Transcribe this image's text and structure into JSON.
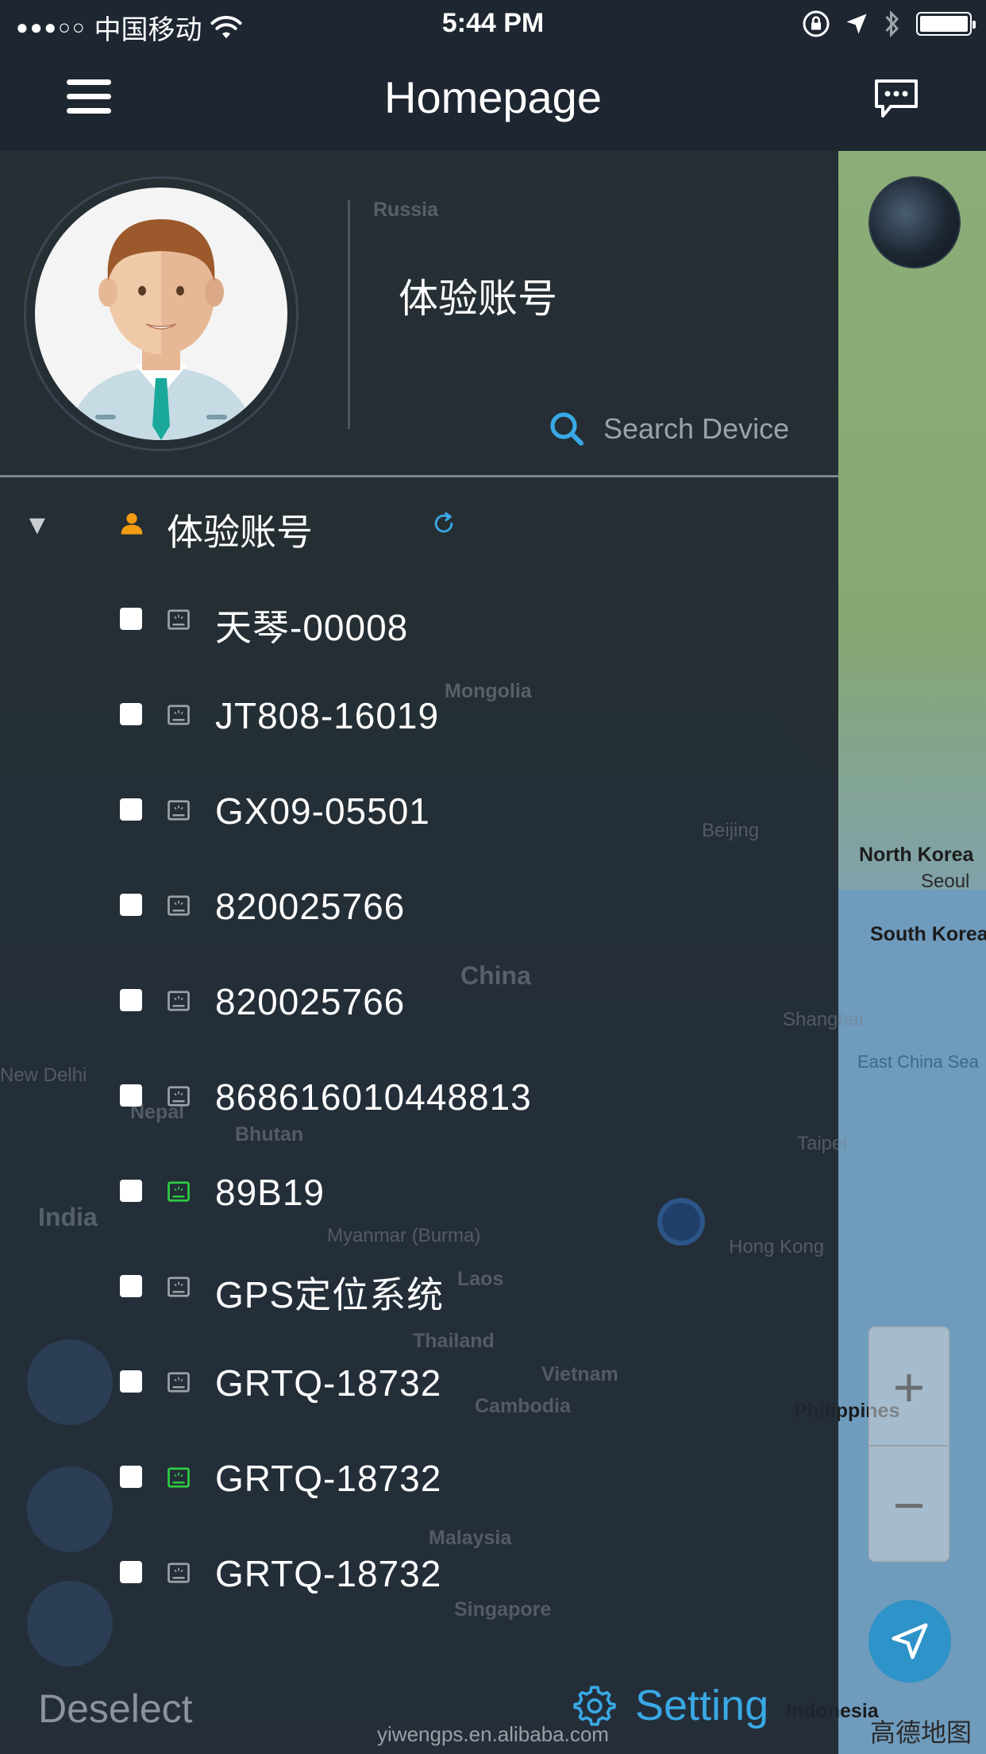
{
  "status_bar": {
    "signal": "●●●○○",
    "carrier": "中国移动",
    "time": "5:44 PM"
  },
  "nav": {
    "title": "Homepage",
    "menu_icon": "hamburger-menu-icon",
    "message_icon": "chat-bubble-icon"
  },
  "drawer": {
    "account_name": "体验账号",
    "search_placeholder": "Search Device",
    "group": {
      "label": "体验账号"
    },
    "devices": [
      {
        "label": "天琴-00008",
        "online": false
      },
      {
        "label": "JT808-16019",
        "online": false
      },
      {
        "label": "GX09-05501",
        "online": false
      },
      {
        "label": "820025766",
        "online": false
      },
      {
        "label": "820025766",
        "online": false
      },
      {
        "label": "868616010448813",
        "online": false
      },
      {
        "label": "89B19",
        "online": true
      },
      {
        "label": "GPS定位系统",
        "online": false
      },
      {
        "label": "GRTQ-18732",
        "online": false
      },
      {
        "label": "GRTQ-18732",
        "online": true
      },
      {
        "label": "GRTQ-18732",
        "online": false
      }
    ],
    "deselect_label": "Deselect",
    "setting_label": "Setting"
  },
  "map": {
    "labels": [
      "Russia",
      "Mongolia",
      "China",
      "India",
      "Myanmar (Burma)",
      "Laos",
      "Thailand",
      "Vietnam",
      "Cambodia",
      "Malaysia",
      "Singapore",
      "Beijing",
      "Shanghai",
      "Hong Kong",
      "Taipei",
      "North Korea",
      "Seoul",
      "South Korea",
      "East China Sea",
      "Philippines",
      "Indonesia",
      "Bhutan",
      "Nepal",
      "New Delhi"
    ],
    "zoom_in": "+",
    "zoom_out": "−",
    "provider": "高德地图"
  },
  "watermark": "yiwengps.en.alibaba.com",
  "colors": {
    "accent": "#39a9e6",
    "online": "#2ecc40",
    "offline": "#9aa0a6",
    "person": "#f39c12"
  }
}
